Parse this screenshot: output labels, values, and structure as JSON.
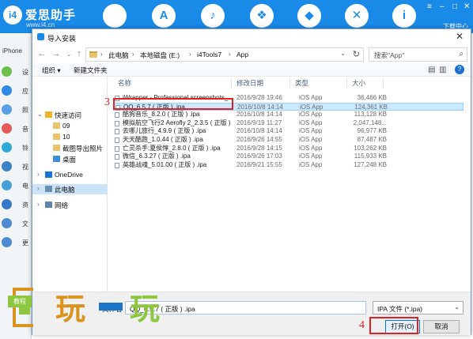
{
  "app": {
    "name": "爱思助手",
    "url": "www.i4.cn",
    "logo_text": "i4",
    "nav_icons": [
      "apple-icon",
      "appstore-icon",
      "bell-icon",
      "dropbox-icon",
      "tools-icon",
      "info-icon"
    ],
    "download_label": "下载中心",
    "device_label": "iPhone",
    "side_items": [
      {
        "label": "设",
        "color": "#6cc04a"
      },
      {
        "label": "应",
        "color": "#2e8ae6"
      },
      {
        "label": "照",
        "color": "#5aa0e6"
      },
      {
        "label": "音",
        "color": "#e85a5a"
      },
      {
        "label": "铃",
        "color": "#2eaad8"
      },
      {
        "label": "视",
        "color": "#3b82c4"
      },
      {
        "label": "电",
        "color": "#47a0d8"
      },
      {
        "label": "资",
        "color": "#3578c8"
      },
      {
        "label": "文",
        "color": "#4f8bd0"
      },
      {
        "label": "更",
        "color": "#4f8bd0"
      }
    ]
  },
  "dialog": {
    "title": "导入安装",
    "breadcrumb": [
      "此电脑",
      "本地磁盘 (E:)",
      "i4Tools7",
      "App"
    ],
    "search_placeholder": "搜索\"App\"",
    "toolbar": {
      "organize": "组织 ▾",
      "new_folder": "新建文件夹"
    },
    "nav_tree": [
      {
        "label": "快速访问",
        "arrow": "⌄",
        "icon": "star",
        "indent": 0
      },
      {
        "label": "09",
        "arrow": "",
        "icon": "folder",
        "indent": 1
      },
      {
        "label": "10",
        "arrow": "",
        "icon": "folder",
        "indent": 1
      },
      {
        "label": "截图导出照片",
        "arrow": "",
        "icon": "folder",
        "indent": 1
      },
      {
        "label": "桌面",
        "arrow": "",
        "icon": "desktop",
        "indent": 1
      },
      {
        "label": "OneDrive",
        "arrow": "›",
        "icon": "cloud",
        "indent": 0
      },
      {
        "label": "此电脑",
        "arrow": "›",
        "icon": "pc",
        "indent": 0,
        "selected": true
      },
      {
        "label": "网络",
        "arrow": "›",
        "icon": "network",
        "indent": 0
      }
    ],
    "columns": [
      "名称",
      "修改日期",
      "类型",
      "大小"
    ],
    "files": [
      {
        "name": "iWrapper - Professional screenshots_...",
        "date": "2016/9/28 19:46",
        "type": "iOS App",
        "size": "36,466 KB"
      },
      {
        "name": "QQ_6.5.7 ( 正版 ) .ipa",
        "date": "2016/10/8 14:14",
        "type": "iOS App",
        "size": "124,361 KB",
        "selected": true
      },
      {
        "name": "酷狗音乐_8.2.0 ( 正版 ) .ipa",
        "date": "2016/10/8 14:14",
        "type": "iOS App",
        "size": "113,128 KB"
      },
      {
        "name": "模拟航空飞行2 Aerofly 2_2.3.5 ( 正版 ) ...",
        "date": "2016/9/19 11:27",
        "type": "iOS App",
        "size": "2,047,148..."
      },
      {
        "name": "去哪儿旅行_4.9.9 ( 正版 ) .ipa",
        "date": "2016/10/8 14:14",
        "type": "iOS App",
        "size": "96,977 KB"
      },
      {
        "name": "天天酷跑_1.0.44 ( 正版 ) .ipa",
        "date": "2016/9/26 14:55",
        "type": "iOS App",
        "size": "87,487 KB"
      },
      {
        "name": "亡灵杀手:夏侯惇_2.8.0 ( 正版 ) .ipa",
        "date": "2016/9/28 14:15",
        "type": "iOS App",
        "size": "103,262 KB"
      },
      {
        "name": "微信_6.3.27 ( 正版 ) .ipa",
        "date": "2016/9/26 17:03",
        "type": "iOS App",
        "size": "115,933 KB"
      },
      {
        "name": "英雄战魂_5.01.00 ( 正版 ) .ipa",
        "date": "2016/9/21 15:55",
        "type": "iOS App",
        "size": "127,248 KB"
      }
    ],
    "filename_label": "文件名",
    "filename_value": "QQ_6.5.7 ( 正版 ) .ipa",
    "filter": "IPA 文件 (*.ipa)",
    "open_label": "打开(O)",
    "cancel_label": "取消"
  },
  "annotations": {
    "step3": "3",
    "step4": "4"
  },
  "watermark": {
    "chars": [
      "玩",
      "玩"
    ],
    "badge": "教程"
  }
}
